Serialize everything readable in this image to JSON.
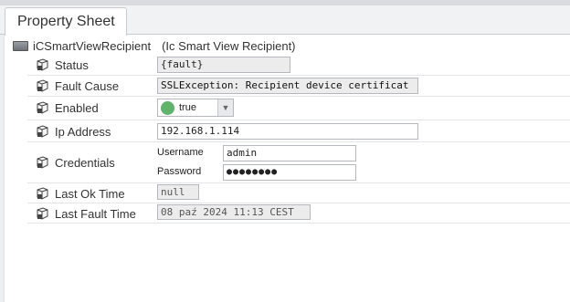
{
  "tab": {
    "label": "Property Sheet"
  },
  "root": {
    "name": "iCSmartViewRecipient",
    "type": "(Ic Smart View Recipient)"
  },
  "properties": {
    "status": {
      "label": "Status",
      "value": "{fault}"
    },
    "fault_cause": {
      "label": "Fault Cause",
      "value": "SSLException: Recipient device certificat"
    },
    "enabled": {
      "label": "Enabled",
      "value": "true"
    },
    "ip_address": {
      "label": "Ip Address",
      "value": "192.168.1.114"
    },
    "credentials": {
      "label": "Credentials",
      "username_label": "Username",
      "username": "admin",
      "password_label": "Password",
      "password": "●●●●●●●●"
    },
    "last_ok_time": {
      "label": "Last Ok Time",
      "value": "null"
    },
    "last_fault_time": {
      "label": "Last Fault Time",
      "value": "08 paź 2024 11:13 CEST"
    }
  },
  "icons": {
    "root": "component-icon",
    "property": "slot-cube-icon",
    "enabled_status_color": "#5fb36a"
  }
}
